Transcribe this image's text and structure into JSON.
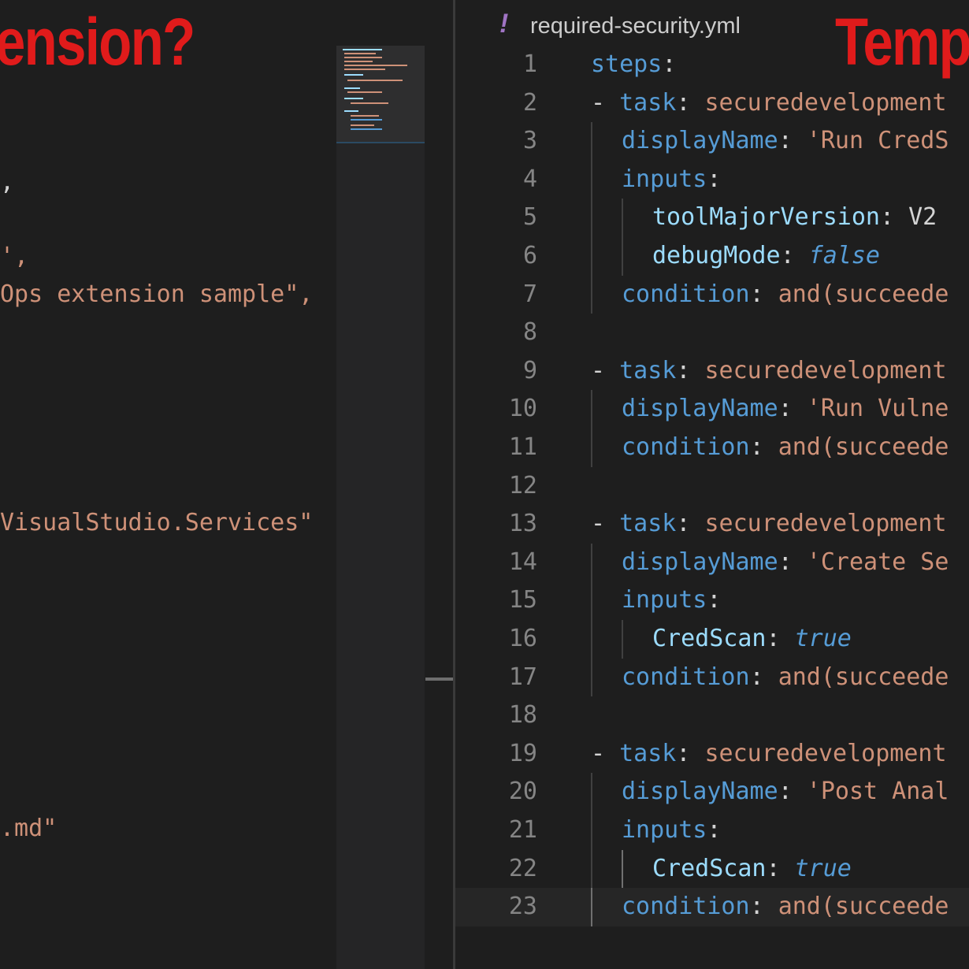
{
  "left_editor": {
    "banner_text": "ension?",
    "lines": [
      {
        "value": ",",
        "kind": "pun"
      },
      {
        "value": "',",
        "kind": "str"
      },
      {
        "value": "Ops extension sample\",",
        "kind": "str"
      },
      {
        "value": "VisualStudio.Services\"",
        "kind": "str"
      },
      {
        "value": ".md\"",
        "kind": "str"
      }
    ]
  },
  "right_editor": {
    "banner_text": "Temp",
    "tab": {
      "icon": "!",
      "file_name": "required-security.yml"
    },
    "lines": [
      {
        "n": "1",
        "parts": [
          [
            "steps",
            "k"
          ],
          [
            ":",
            "p"
          ]
        ]
      },
      {
        "n": "2",
        "parts": [
          [
            "- ",
            "p"
          ],
          [
            "task",
            "k"
          ],
          [
            ": ",
            "p"
          ],
          [
            "securedevelopment",
            "s"
          ]
        ]
      },
      {
        "n": "3",
        "parts": [
          [
            "displayName",
            "k"
          ],
          [
            ": ",
            "p"
          ],
          [
            "'Run CredS",
            "s"
          ]
        ]
      },
      {
        "n": "4",
        "parts": [
          [
            "inputs",
            "k"
          ],
          [
            ":",
            "p"
          ]
        ]
      },
      {
        "n": "5",
        "parts": [
          [
            "toolMajorVersion",
            "kl"
          ],
          [
            ": ",
            "p"
          ],
          [
            "V2",
            "ds"
          ]
        ]
      },
      {
        "n": "6",
        "parts": [
          [
            "debugMode",
            "kl"
          ],
          [
            ": ",
            "p"
          ],
          [
            "false",
            "b"
          ]
        ]
      },
      {
        "n": "7",
        "parts": [
          [
            "condition",
            "k"
          ],
          [
            ": ",
            "p"
          ],
          [
            "and(succeede",
            "s"
          ]
        ]
      },
      {
        "n": "8",
        "parts": []
      },
      {
        "n": "9",
        "parts": [
          [
            "- ",
            "p"
          ],
          [
            "task",
            "k"
          ],
          [
            ": ",
            "p"
          ],
          [
            "securedevelopment",
            "s"
          ]
        ]
      },
      {
        "n": "10",
        "parts": [
          [
            "displayName",
            "k"
          ],
          [
            ": ",
            "p"
          ],
          [
            "'Run Vulne",
            "s"
          ]
        ]
      },
      {
        "n": "11",
        "parts": [
          [
            "condition",
            "k"
          ],
          [
            ": ",
            "p"
          ],
          [
            "and(succeede",
            "s"
          ]
        ]
      },
      {
        "n": "12",
        "parts": []
      },
      {
        "n": "13",
        "parts": [
          [
            "- ",
            "p"
          ],
          [
            "task",
            "k"
          ],
          [
            ": ",
            "p"
          ],
          [
            "securedevelopment",
            "s"
          ]
        ]
      },
      {
        "n": "14",
        "parts": [
          [
            "displayName",
            "k"
          ],
          [
            ": ",
            "p"
          ],
          [
            "'Create Se",
            "s"
          ]
        ]
      },
      {
        "n": "15",
        "parts": [
          [
            "inputs",
            "k"
          ],
          [
            ":",
            "p"
          ]
        ]
      },
      {
        "n": "16",
        "parts": [
          [
            "CredScan",
            "kl"
          ],
          [
            ": ",
            "p"
          ],
          [
            "true",
            "b"
          ]
        ]
      },
      {
        "n": "17",
        "parts": [
          [
            "condition",
            "k"
          ],
          [
            ": ",
            "p"
          ],
          [
            "and(succeede",
            "s"
          ]
        ]
      },
      {
        "n": "18",
        "parts": []
      },
      {
        "n": "19",
        "parts": [
          [
            "- ",
            "p"
          ],
          [
            "task",
            "k"
          ],
          [
            ": ",
            "p"
          ],
          [
            "securedevelopment",
            "s"
          ]
        ]
      },
      {
        "n": "20",
        "parts": [
          [
            "displayName",
            "k"
          ],
          [
            ": ",
            "p"
          ],
          [
            "'Post Anal",
            "s"
          ]
        ]
      },
      {
        "n": "21",
        "parts": [
          [
            "inputs",
            "k"
          ],
          [
            ":",
            "p"
          ]
        ]
      },
      {
        "n": "22",
        "parts": [
          [
            "CredScan",
            "kl"
          ],
          [
            ": ",
            "p"
          ],
          [
            "true",
            "b"
          ]
        ]
      },
      {
        "n": "23",
        "parts": [
          [
            "condition",
            "k"
          ],
          [
            ": ",
            "p"
          ],
          [
            "and(succeede",
            "s"
          ]
        ]
      }
    ],
    "active_line": "23"
  }
}
